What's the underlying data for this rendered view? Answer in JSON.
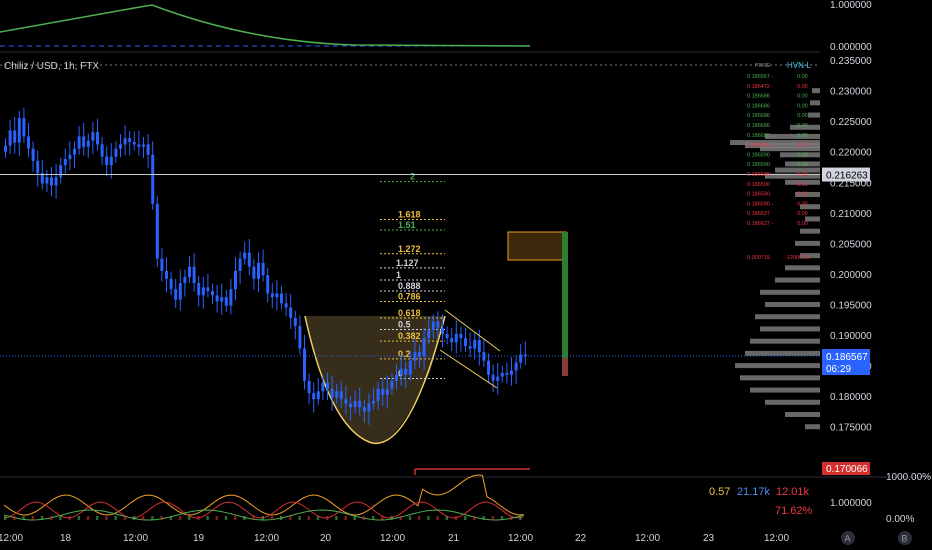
{
  "chart_data": {
    "type": "candlestick",
    "title": "Chiliz / USD, 1h, FTX",
    "ylim": [
      0.1725,
      0.2355
    ],
    "y_ticks": [
      "0.235000",
      "0.230000",
      "0.225000",
      "0.220000",
      "0.215000",
      "0.210000",
      "0.205000",
      "0.200000",
      "0.195000",
      "0.190000",
      "0.185000",
      "0.180000",
      "0.175000"
    ],
    "x_ticks": [
      "12:00",
      "18",
      "12:00",
      "19",
      "12:00",
      "20",
      "12:00",
      "21",
      "12:00",
      "22",
      "12:00",
      "23",
      "12:00"
    ],
    "price_line": {
      "value": "0.216263",
      "value_num": 0.216263
    },
    "last_price": {
      "value": "0.186567",
      "value_num": 0.186567,
      "countdown": "06:29"
    },
    "low_marker": {
      "value": "0.170066",
      "value_num": 0.170066
    },
    "candles_close": [
      0.221,
      0.2235,
      0.2215,
      0.2255,
      0.2225,
      0.2205,
      0.2185,
      0.2165,
      0.2148,
      0.2158,
      0.2145,
      0.2158,
      0.2178,
      0.2188,
      0.2195,
      0.2205,
      0.2225,
      0.2208,
      0.2218,
      0.2232,
      0.2212,
      0.2192,
      0.2178,
      0.2192,
      0.2205,
      0.2212,
      0.2222,
      0.2216,
      0.2212,
      0.2208,
      0.2212,
      0.2195,
      0.2115,
      0.2025,
      0.2005,
      0.1992,
      0.1975,
      0.1958,
      0.1985,
      0.1995,
      0.2012,
      0.1985,
      0.1965,
      0.1978,
      0.1972,
      0.1965,
      0.1955,
      0.1962,
      0.1948,
      0.1975,
      0.2005,
      0.2025,
      0.2035,
      0.2012,
      0.1992,
      0.2018,
      0.1998,
      0.1968,
      0.1962,
      0.1968,
      0.1952,
      0.1945,
      0.1928,
      0.1915,
      0.1878,
      0.1825,
      0.1805,
      0.1795,
      0.1808,
      0.1822,
      0.1812,
      0.1798,
      0.1808,
      0.1795,
      0.1788,
      0.1782,
      0.1792,
      0.1782,
      0.1775,
      0.1788,
      0.1792,
      0.1812,
      0.1802,
      0.1812,
      0.1825,
      0.1835,
      0.1845,
      0.1835,
      0.1858,
      0.1872,
      0.1865,
      0.1895,
      0.1908,
      0.1922,
      0.1912,
      0.1902,
      0.1895,
      0.1888,
      0.1902,
      0.1895,
      0.1882,
      0.1878,
      0.1892,
      0.1872,
      0.1858,
      0.1835,
      0.1825,
      0.1832,
      0.1838,
      0.1835,
      0.1842,
      0.1855,
      0.1868,
      0.1865
    ],
    "fib_levels": [
      {
        "label": "2",
        "price": 0.2151,
        "color": "#4caf50"
      },
      {
        "label": "1.618",
        "price": 0.2089,
        "color": "#f0c040"
      },
      {
        "label": "1.51",
        "price": 0.2072,
        "color": "#4caf50"
      },
      {
        "label": "1.272",
        "price": 0.2033,
        "color": "#f0c040"
      },
      {
        "label": "1.127",
        "price": 0.201,
        "color": "#d1d4dc"
      },
      {
        "label": "1",
        "price": 0.199,
        "color": "#d1d4dc"
      },
      {
        "label": "0.888",
        "price": 0.1972,
        "color": "#d1d4dc"
      },
      {
        "label": "0.786",
        "price": 0.1955,
        "color": "#f0c040"
      },
      {
        "label": "0.618",
        "price": 0.1928,
        "color": "#f0c040"
      },
      {
        "label": "0.5",
        "price": 0.1909,
        "color": "#d1d4dc"
      },
      {
        "label": "0.382",
        "price": 0.189,
        "color": "#f0c040"
      },
      {
        "label": "0.2",
        "price": 0.1861,
        "color": "#f0c040"
      },
      {
        "label": "0",
        "price": 0.1829,
        "color": "#d1d4dc"
      }
    ],
    "order_list_header": {
      "col1": "PRICE",
      "col2": "HVN-L"
    },
    "order_list": [
      {
        "price": "0.186567 -",
        "qty": "0.00",
        "color": "#4caf50"
      },
      {
        "price": "0.186472 -",
        "qty": "0.00",
        "color": "#f23645"
      },
      {
        "price": "0.186686",
        "qty": "0.00",
        "color": "#4caf50"
      },
      {
        "price": "0.186686",
        "qty": "0.00",
        "color": "#4caf50"
      },
      {
        "price": "0.186686",
        "qty": "0.00",
        "color": "#4caf50"
      },
      {
        "price": "0.186686",
        "qty": "0.00",
        "color": "#4caf50"
      },
      {
        "price": "0.186686",
        "qty": "0.00",
        "color": "#4caf50"
      },
      {
        "price": "0.186686 -",
        "qty": "0.00",
        "color": "#f23645"
      },
      {
        "price": "0.186590",
        "qty": "0.00",
        "color": "#4caf50"
      },
      {
        "price": "0.186590",
        "qty": "0.00",
        "color": "#4caf50"
      },
      {
        "price": "0.186590",
        "qty": "0.00",
        "color": "#f23645"
      },
      {
        "price": "0.186590",
        "qty": "0.00",
        "color": "#f23645"
      },
      {
        "price": "0.186590",
        "qty": "0.00",
        "color": "#f23645"
      },
      {
        "price": "0.186590 -",
        "qty": "0.00",
        "color": "#f23645"
      },
      {
        "price": "0.186627",
        "qty": "0.00",
        "color": "#f23645"
      },
      {
        "price": "0.186627 -",
        "qty": "0.00",
        "color": "#f23645"
      }
    ],
    "order_list_summary": {
      "price": "0.000715",
      "qty": "-12006.25"
    },
    "top_pane": {
      "y_ticks": [
        "1.000000",
        "0.000000"
      ]
    },
    "bottom_pane": {
      "values": [
        {
          "text": "0.57",
          "color": "#f0c040"
        },
        {
          "text": "21.17k",
          "color": "#4c8ef7"
        },
        {
          "text": "12.01k",
          "color": "#f23645"
        }
      ],
      "percent": {
        "text": "71.62%",
        "color": "#f23645"
      },
      "y_ticks": [
        "1000.00%",
        "1.000000",
        "0.00%"
      ]
    },
    "footer_buttons": [
      "A",
      "B"
    ],
    "colors": {
      "up": "#2962ff",
      "down": "#2962ff",
      "background": "#000000",
      "profile": "#7a7a7a",
      "accent": "#f0c040"
    }
  }
}
